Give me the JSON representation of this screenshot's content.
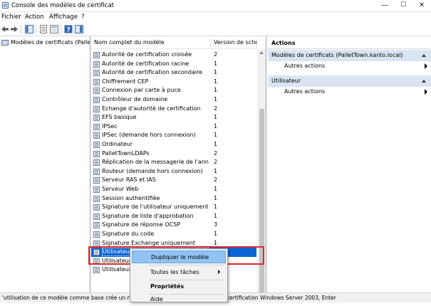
{
  "window": {
    "title": "Console des modèles de certificat",
    "controls": {
      "minimize": "—",
      "maximize": "☐",
      "close": "✕"
    }
  },
  "menubar": {
    "items": [
      "Fichier",
      "Action",
      "Affichage",
      "?"
    ]
  },
  "toolbar": {
    "icons": [
      "back-arrow-icon",
      "forward-arrow-icon",
      "console-tree-icon",
      "properties-icon",
      "help-icon",
      "show-pane-icon"
    ]
  },
  "tree": {
    "root_label": "Modèles de certificats (PalletTown"
  },
  "list": {
    "columns": {
      "name": "Nom complet du modèle",
      "version": "Version de schéma"
    },
    "rows": [
      {
        "name": "Autorité de certification croisée",
        "version": "2"
      },
      {
        "name": "Autorité de certification racine",
        "version": "1"
      },
      {
        "name": "Autorité de certification secondaire",
        "version": "1"
      },
      {
        "name": "Chiffrement CEP",
        "version": "1"
      },
      {
        "name": "Connexion par carte à puce",
        "version": "1"
      },
      {
        "name": "Contrôleur de domaine",
        "version": "1"
      },
      {
        "name": "Échange d'autorité de certification",
        "version": "2"
      },
      {
        "name": "EFS basique",
        "version": "1"
      },
      {
        "name": "IPSec",
        "version": "1"
      },
      {
        "name": "IPSec (demande hors connexion)",
        "version": "1"
      },
      {
        "name": "Ordinateur",
        "version": "1"
      },
      {
        "name": "PalletTownLDAPs",
        "version": "2"
      },
      {
        "name": "Réplication de la messagerie de l'annuaire",
        "version": "2"
      },
      {
        "name": "Routeur (demande hors connexion)",
        "version": "1"
      },
      {
        "name": "Serveur RAS et IAS",
        "version": "2"
      },
      {
        "name": "Serveur Web",
        "version": "1"
      },
      {
        "name": "Session authentifiée",
        "version": "1"
      },
      {
        "name": "Signature de l'utilisateur uniquement",
        "version": "1"
      },
      {
        "name": "Signature de liste d'approbation",
        "version": "1"
      },
      {
        "name": "Signature de réponse OCSP",
        "version": "3"
      },
      {
        "name": "Signature du code",
        "version": "1"
      },
      {
        "name": "Signature Exchange uniquement",
        "version": "1"
      },
      {
        "name": "Utilisateur",
        "version": ""
      },
      {
        "name": "Utilisateur de",
        "version": ""
      },
      {
        "name": "Utilisateur Ex",
        "version": ""
      }
    ],
    "selected_index": 22
  },
  "actions": {
    "header": "Actions",
    "groups": [
      {
        "title": "Modèles de certificats (PalletTown.kanto.local)",
        "items": [
          "Autres actions"
        ]
      },
      {
        "title": "Utilisateur",
        "items": [
          "Autres actions"
        ]
      }
    ]
  },
  "context_menu": {
    "items": [
      {
        "label": "Dupliquer le modèle",
        "highlighted": true,
        "bold": false,
        "submenu": false
      },
      {
        "label": "Toutes les tâches",
        "highlighted": false,
        "bold": false,
        "submenu": true
      },
      {
        "label": "Propriétés",
        "highlighted": false,
        "bold": true,
        "submenu": false
      },
      {
        "label": "Aide",
        "highlighted": false,
        "bold": false,
        "submenu": false
      }
    ]
  },
  "statusbar": {
    "left_text": "'utilisation de ce modèle comme base crée un modèle",
    "right_text": "certification Windows Server 2003, Enter"
  },
  "colors": {
    "selection": "#0a64d2",
    "menu_highlight": "#91c3f3",
    "callout_border": "#e0272b",
    "actions_group_bg": "#d9e5f3"
  }
}
